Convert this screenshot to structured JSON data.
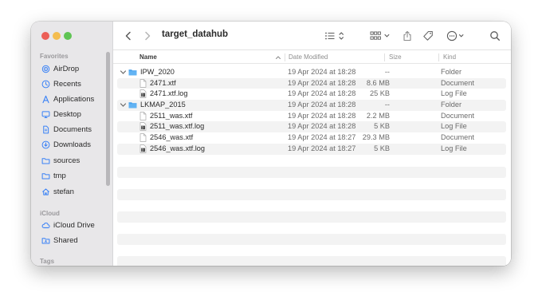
{
  "window": {
    "title": "target_datahub"
  },
  "sidebar": {
    "favorites_label": "Favorites",
    "favorites": [
      {
        "label": "AirDrop",
        "icon": "airdrop-icon"
      },
      {
        "label": "Recents",
        "icon": "clock-icon"
      },
      {
        "label": "Applications",
        "icon": "applications-icon"
      },
      {
        "label": "Desktop",
        "icon": "desktop-icon"
      },
      {
        "label": "Documents",
        "icon": "document-icon"
      },
      {
        "label": "Downloads",
        "icon": "download-icon"
      },
      {
        "label": "sources",
        "icon": "folder-icon"
      },
      {
        "label": "tmp",
        "icon": "folder-icon"
      },
      {
        "label": "stefan",
        "icon": "home-icon"
      }
    ],
    "icloud_label": "iCloud",
    "icloud": [
      {
        "label": "iCloud Drive",
        "icon": "cloud-icon"
      },
      {
        "label": "Shared",
        "icon": "shared-folder-icon"
      }
    ],
    "tags_label": "Tags"
  },
  "columns": {
    "name": "Name",
    "date": "Date Modified",
    "size": "Size",
    "kind": "Kind"
  },
  "files": [
    {
      "name": "IPW_2020",
      "date": "19 Apr 2024 at 18:28",
      "size": "--",
      "kind": "Folder",
      "type": "folder",
      "level": 0
    },
    {
      "name": "2471.xtf",
      "date": "19 Apr 2024 at 18:28",
      "size": "8.6 MB",
      "kind": "Document",
      "type": "document",
      "level": 1
    },
    {
      "name": "2471.xtf.log",
      "date": "19 Apr 2024 at 18:28",
      "size": "25 KB",
      "kind": "Log File",
      "type": "log",
      "level": 1
    },
    {
      "name": "LKMAP_2015",
      "date": "19 Apr 2024 at 18:28",
      "size": "--",
      "kind": "Folder",
      "type": "folder",
      "level": 0
    },
    {
      "name": "2511_was.xtf",
      "date": "19 Apr 2024 at 18:28",
      "size": "2.2 MB",
      "kind": "Document",
      "type": "document",
      "level": 1
    },
    {
      "name": "2511_was.xtf.log",
      "date": "19 Apr 2024 at 18:28",
      "size": "5 KB",
      "kind": "Log File",
      "type": "log",
      "level": 1
    },
    {
      "name": "2546_was.xtf",
      "date": "19 Apr 2024 at 18:27",
      "size": "29.3 MB",
      "kind": "Document",
      "type": "document",
      "level": 1
    },
    {
      "name": "2546_was.xtf.log",
      "date": "19 Apr 2024 at 18:27",
      "size": "5 KB",
      "kind": "Log File",
      "type": "log",
      "level": 1
    }
  ],
  "colors": {
    "accent": "#3a82f6",
    "folder": "#4aa3ee",
    "sidebar_bg": "#e8e7e9"
  }
}
